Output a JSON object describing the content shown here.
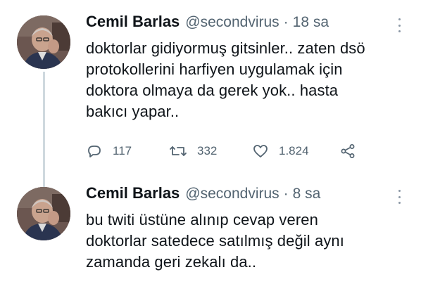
{
  "tweets": [
    {
      "author": {
        "name": "Cemil Barlas",
        "handle": "@secondvirus"
      },
      "separator": "·",
      "time": "18 sa",
      "text_lines": [
        "doktorlar gidiyormuş gitsinler.. zaten dsö",
        "protokollerini harfiyen uygulamak için",
        "doktora olmaya da gerek yok.. hasta",
        "bakıcı yapar.."
      ],
      "actions": {
        "reply_count": "117",
        "retweet_count": "332",
        "like_count": "1.824"
      }
    },
    {
      "author": {
        "name": "Cemil Barlas",
        "handle": "@secondvirus"
      },
      "separator": "·",
      "time": "8 sa",
      "text_lines": [
        "bu twiti üstüne alınıp cevap veren",
        "doktorlar satedece satılmış değil aynı",
        "zamanda geri zekalı da.."
      ]
    }
  ],
  "icons": {
    "reply": "reply-icon",
    "retweet": "retweet-icon",
    "like": "heart-icon",
    "share": "share-icon",
    "more": "more-options-icon"
  },
  "colors": {
    "text": "#0f1419",
    "secondary": "#536471",
    "thread_line": "#cfd9de"
  }
}
